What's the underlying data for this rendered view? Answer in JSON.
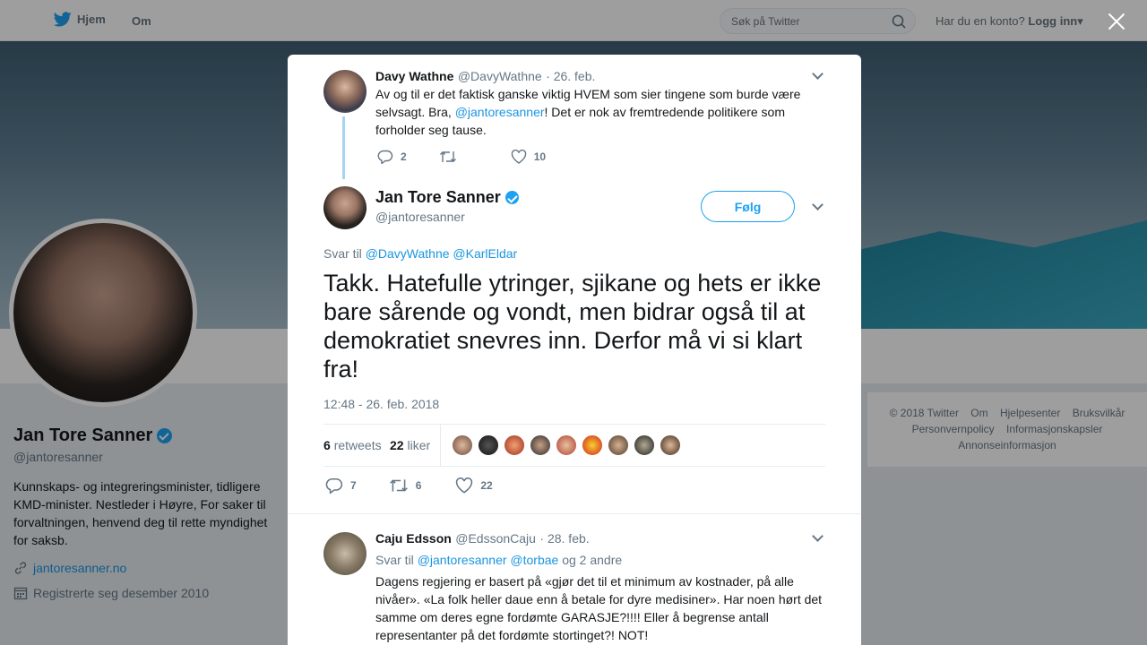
{
  "nav": {
    "home_label": "Hjem",
    "about_label": "Om",
    "search_placeholder": "Søk på Twitter",
    "account_prompt": "Har du en konto?",
    "login_label": "Logg inn"
  },
  "profile": {
    "name": "Jan Tore Sanner",
    "handle": "@jantoresanner",
    "bio": "Kunnskaps- og integreringsminister, tidligere KMD-minister. Nestleder i Høyre, For saker til forvaltningen, henvend deg til rette myndighet for saksb.",
    "link": "jantoresanner.no",
    "joined": "Registrerte seg desember 2010"
  },
  "footer": {
    "items": [
      "© 2018 Twitter",
      "Om",
      "Hjelpesenter",
      "Bruksvilkår",
      "Personvernpolicy",
      "Informasjonskapsler",
      "Annonseinformasjon"
    ]
  },
  "parent_tweet": {
    "name": "Davy Wathne",
    "handle": "@DavyWathne",
    "date": "· 26. feb.",
    "text_a": "Av og til er det faktisk ganske viktig HVEM som sier tingene som burde være selvsagt. Bra, ",
    "mention": "@jantoresanner",
    "text_b": "! Det er nok av fremtredende politikere som forholder seg tause.",
    "replies": "2",
    "retweets": "",
    "likes": "10"
  },
  "main_tweet": {
    "name": "Jan Tore Sanner",
    "handle": "@jantoresanner",
    "follow_label": "Følg",
    "reply_to_label": "Svar til",
    "reply_to_1": "@DavyWathne",
    "reply_to_2": "@KarlEldar",
    "text": "Takk. Hatefulle ytringer, sjikane og hets er ikke bare sårende og vondt, men bidrar også til at demokratiet snevres inn. Derfor må vi si klart fra!",
    "timestamp": "12:48 - 26. feb. 2018",
    "retweets_count": "6",
    "retweets_label": "retweets",
    "likes_count": "22",
    "likes_label": "liker",
    "replies": "7",
    "retweets": "6",
    "likes": "22"
  },
  "reply_tweet": {
    "name": "Caju Edsson",
    "handle": "@EdssonCaju",
    "date": "· 28. feb.",
    "reply_to_label": "Svar til",
    "reply_to_1": "@jantoresanner",
    "reply_to_2": "@torbae",
    "reply_to_more": "og 2 andre",
    "text": "Dagens regjering er basert på «gjør det til et minimum av kostnader, på alle nivåer». «La folk heller daue enn å betale for dyre medisiner». Har noen hørt det samme om deres egne fordømte GARASJE?!!!! Eller å begrense antall representanter på det fordømte stortinget?! NOT!"
  },
  "colors": {
    "accent": "#1da1f2",
    "link": "#1b95e0",
    "text": "#14171a",
    "muted": "#657786"
  },
  "icons": [
    "twitter-bird-icon",
    "search-icon",
    "close-icon",
    "reply-icon",
    "retweet-icon",
    "like-icon",
    "verified-icon",
    "link-icon",
    "calendar-icon",
    "chevron-down-icon"
  ]
}
